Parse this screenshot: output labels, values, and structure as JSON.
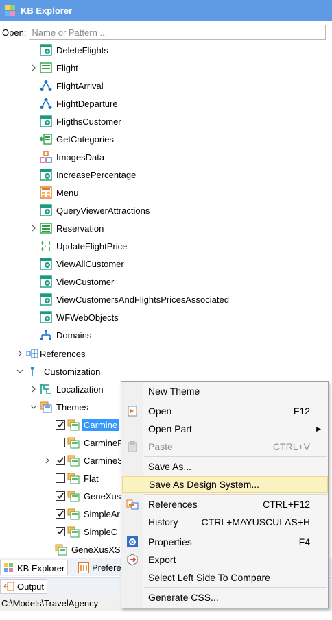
{
  "window": {
    "title": "KB Explorer"
  },
  "open": {
    "label": "Open:",
    "placeholder": "Name or Pattern ..."
  },
  "tree": {
    "objects": [
      {
        "label": "DeleteFlights",
        "icon": "webpanel-icon"
      },
      {
        "label": "Flight",
        "icon": "transaction-icon"
      },
      {
        "label": "FlightArrival",
        "icon": "sdt-icon"
      },
      {
        "label": "FlightDeparture",
        "icon": "sdt-icon"
      },
      {
        "label": "FligthsCustomer",
        "icon": "webpanel-icon"
      },
      {
        "label": "GetCategories",
        "icon": "dataprovider-icon"
      },
      {
        "label": "ImagesData",
        "icon": "structure-icon"
      },
      {
        "label": "IncreasePercentage",
        "icon": "webpanel-icon"
      },
      {
        "label": "Menu",
        "icon": "menu-icon"
      },
      {
        "label": "QueryViewerAttractions",
        "icon": "webpanel-icon"
      },
      {
        "label": "Reservation",
        "icon": "transaction-icon"
      },
      {
        "label": "UpdateFlightPrice",
        "icon": "procedure-icon"
      },
      {
        "label": "ViewAllCustomer",
        "icon": "webpanel-icon"
      },
      {
        "label": "ViewCustomer",
        "icon": "webpanel-icon"
      },
      {
        "label": "ViewCustomersAndFlightsPricesAssociated",
        "icon": "webpanel-icon"
      },
      {
        "label": "WFWebObjects",
        "icon": "webpanel-icon"
      },
      {
        "label": "Domains",
        "icon": "domain-icon"
      }
    ],
    "references": "References",
    "customization": "Customization",
    "localization": "Localization",
    "themes": "Themes",
    "theme_items": [
      {
        "label": "Carmine",
        "checked": true
      },
      {
        "label": "CarmineF",
        "checked": false
      },
      {
        "label": "CarmineS",
        "checked": true
      },
      {
        "label": "Flat",
        "checked": false
      },
      {
        "label": "GeneXus",
        "checked": true
      },
      {
        "label": "SimpleAr",
        "checked": true
      },
      {
        "label": "SimpleC",
        "checked": true
      }
    ],
    "genexus_xs": "GeneXusXS"
  },
  "context_menu": {
    "new_theme": "New Theme",
    "open": "Open",
    "open_sc": "F12",
    "open_part": "Open Part",
    "paste": "Paste",
    "paste_sc": "CTRL+V",
    "save_as": "Save As...",
    "save_as_ds": "Save As Design System...",
    "references": "References",
    "references_sc": "CTRL+F12",
    "history": "History",
    "history_sc": "CTRL+MAYUSCULAS+H",
    "properties": "Properties",
    "properties_sc": "F4",
    "export": "Export",
    "select_left": "Select Left Side To Compare",
    "generate_css": "Generate CSS..."
  },
  "bottom_tabs": {
    "kb_explorer": "KB Explorer",
    "preferences": "Prefere"
  },
  "output_tab": "Output",
  "status_path": "C:\\Models\\TravelAgency"
}
